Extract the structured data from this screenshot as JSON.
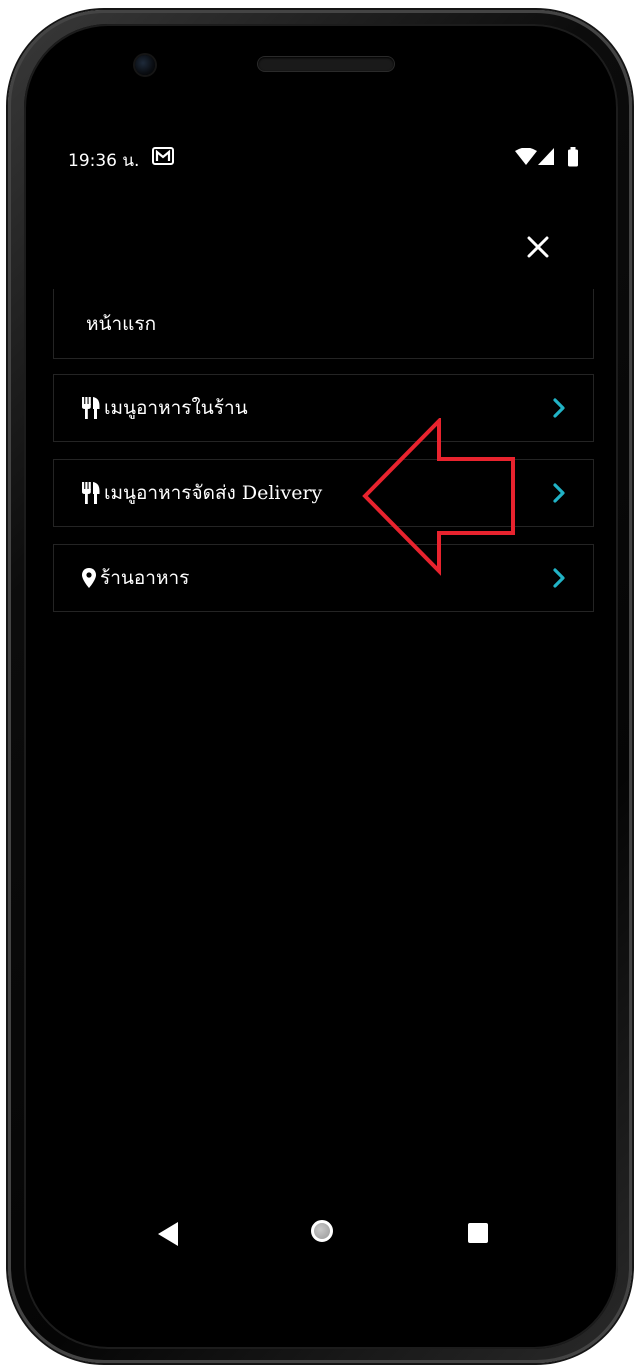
{
  "status_bar": {
    "time": "19:36 น.",
    "icons": [
      "mail-icon",
      "wifi-icon",
      "signal-icon",
      "battery-icon"
    ]
  },
  "colors": {
    "background": "#000000",
    "text": "#ffffff",
    "chevron": "#21b3c6",
    "border": "#242424",
    "annotation": "#e8232e"
  },
  "menu": {
    "close_icon": "close-icon",
    "items": [
      {
        "label": "หน้าแรก",
        "icon": ""
      },
      {
        "label": "เมนูอาหารในร้าน",
        "icon": "utensils-icon"
      },
      {
        "label": "เมนูอาหารจัดส่ง Delivery",
        "icon": "utensils-icon"
      },
      {
        "label": "ร้านอาหาร",
        "icon": "map-marker-icon"
      }
    ]
  },
  "nav_bar": {
    "buttons": [
      "back-icon",
      "home-icon",
      "recents-icon"
    ]
  }
}
